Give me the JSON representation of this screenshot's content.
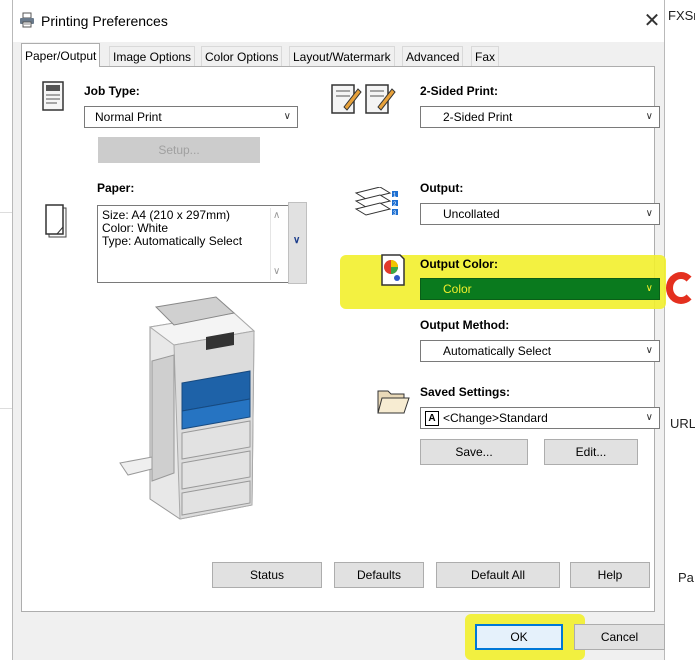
{
  "dialog": {
    "title": "Printing Preferences",
    "close_glyph": "✕"
  },
  "tabs": [
    {
      "label": "Paper/Output",
      "active": true
    },
    {
      "label": "Image Options",
      "active": false
    },
    {
      "label": "Color Options",
      "active": false
    },
    {
      "label": "Layout/Watermark",
      "active": false
    },
    {
      "label": "Advanced",
      "active": false
    },
    {
      "label": "Fax",
      "active": false
    }
  ],
  "job_type": {
    "label": "Job Type:",
    "value": "Normal Print",
    "setup_button": "Setup..."
  },
  "two_sided": {
    "label": "2-Sided Print:",
    "value": "2-Sided Print"
  },
  "paper": {
    "label": "Paper:",
    "lines": [
      "Size: A4 (210 x 297mm)",
      "Color: White",
      "Type: Automatically Select"
    ]
  },
  "output": {
    "label": "Output:",
    "value": "Uncollated"
  },
  "output_color": {
    "label": "Output Color:",
    "value": "Color",
    "selection_color": "#0a7a1e",
    "highlight_color": "#f2ef2c"
  },
  "output_method": {
    "label": "Output Method:",
    "value": "Automatically Select"
  },
  "saved_settings": {
    "label": "Saved Settings:",
    "value": "<Change>Standard",
    "value_icon": "A",
    "save_button": "Save...",
    "edit_button": "Edit..."
  },
  "bottom_buttons": {
    "status": "Status",
    "defaults": "Defaults",
    "default_all": "Default All",
    "help": "Help"
  },
  "footer_buttons": {
    "ok": "OK",
    "cancel": "Cancel"
  },
  "background": {
    "top_right": "FXSr",
    "mid_right": "URL",
    "bottom_right": "Pa"
  }
}
